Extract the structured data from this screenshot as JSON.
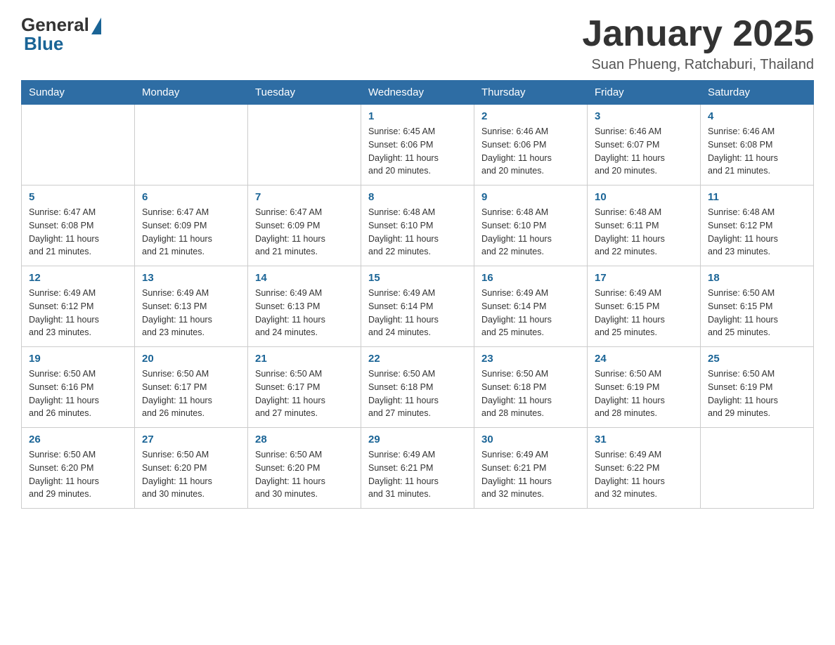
{
  "header": {
    "logo_general": "General",
    "logo_blue": "Blue",
    "month_title": "January 2025",
    "location": "Suan Phueng, Ratchaburi, Thailand"
  },
  "columns": [
    "Sunday",
    "Monday",
    "Tuesday",
    "Wednesday",
    "Thursday",
    "Friday",
    "Saturday"
  ],
  "weeks": [
    [
      {
        "day": "",
        "info": ""
      },
      {
        "day": "",
        "info": ""
      },
      {
        "day": "",
        "info": ""
      },
      {
        "day": "1",
        "info": "Sunrise: 6:45 AM\nSunset: 6:06 PM\nDaylight: 11 hours\nand 20 minutes."
      },
      {
        "day": "2",
        "info": "Sunrise: 6:46 AM\nSunset: 6:06 PM\nDaylight: 11 hours\nand 20 minutes."
      },
      {
        "day": "3",
        "info": "Sunrise: 6:46 AM\nSunset: 6:07 PM\nDaylight: 11 hours\nand 20 minutes."
      },
      {
        "day": "4",
        "info": "Sunrise: 6:46 AM\nSunset: 6:08 PM\nDaylight: 11 hours\nand 21 minutes."
      }
    ],
    [
      {
        "day": "5",
        "info": "Sunrise: 6:47 AM\nSunset: 6:08 PM\nDaylight: 11 hours\nand 21 minutes."
      },
      {
        "day": "6",
        "info": "Sunrise: 6:47 AM\nSunset: 6:09 PM\nDaylight: 11 hours\nand 21 minutes."
      },
      {
        "day": "7",
        "info": "Sunrise: 6:47 AM\nSunset: 6:09 PM\nDaylight: 11 hours\nand 21 minutes."
      },
      {
        "day": "8",
        "info": "Sunrise: 6:48 AM\nSunset: 6:10 PM\nDaylight: 11 hours\nand 22 minutes."
      },
      {
        "day": "9",
        "info": "Sunrise: 6:48 AM\nSunset: 6:10 PM\nDaylight: 11 hours\nand 22 minutes."
      },
      {
        "day": "10",
        "info": "Sunrise: 6:48 AM\nSunset: 6:11 PM\nDaylight: 11 hours\nand 22 minutes."
      },
      {
        "day": "11",
        "info": "Sunrise: 6:48 AM\nSunset: 6:12 PM\nDaylight: 11 hours\nand 23 minutes."
      }
    ],
    [
      {
        "day": "12",
        "info": "Sunrise: 6:49 AM\nSunset: 6:12 PM\nDaylight: 11 hours\nand 23 minutes."
      },
      {
        "day": "13",
        "info": "Sunrise: 6:49 AM\nSunset: 6:13 PM\nDaylight: 11 hours\nand 23 minutes."
      },
      {
        "day": "14",
        "info": "Sunrise: 6:49 AM\nSunset: 6:13 PM\nDaylight: 11 hours\nand 24 minutes."
      },
      {
        "day": "15",
        "info": "Sunrise: 6:49 AM\nSunset: 6:14 PM\nDaylight: 11 hours\nand 24 minutes."
      },
      {
        "day": "16",
        "info": "Sunrise: 6:49 AM\nSunset: 6:14 PM\nDaylight: 11 hours\nand 25 minutes."
      },
      {
        "day": "17",
        "info": "Sunrise: 6:49 AM\nSunset: 6:15 PM\nDaylight: 11 hours\nand 25 minutes."
      },
      {
        "day": "18",
        "info": "Sunrise: 6:50 AM\nSunset: 6:15 PM\nDaylight: 11 hours\nand 25 minutes."
      }
    ],
    [
      {
        "day": "19",
        "info": "Sunrise: 6:50 AM\nSunset: 6:16 PM\nDaylight: 11 hours\nand 26 minutes."
      },
      {
        "day": "20",
        "info": "Sunrise: 6:50 AM\nSunset: 6:17 PM\nDaylight: 11 hours\nand 26 minutes."
      },
      {
        "day": "21",
        "info": "Sunrise: 6:50 AM\nSunset: 6:17 PM\nDaylight: 11 hours\nand 27 minutes."
      },
      {
        "day": "22",
        "info": "Sunrise: 6:50 AM\nSunset: 6:18 PM\nDaylight: 11 hours\nand 27 minutes."
      },
      {
        "day": "23",
        "info": "Sunrise: 6:50 AM\nSunset: 6:18 PM\nDaylight: 11 hours\nand 28 minutes."
      },
      {
        "day": "24",
        "info": "Sunrise: 6:50 AM\nSunset: 6:19 PM\nDaylight: 11 hours\nand 28 minutes."
      },
      {
        "day": "25",
        "info": "Sunrise: 6:50 AM\nSunset: 6:19 PM\nDaylight: 11 hours\nand 29 minutes."
      }
    ],
    [
      {
        "day": "26",
        "info": "Sunrise: 6:50 AM\nSunset: 6:20 PM\nDaylight: 11 hours\nand 29 minutes."
      },
      {
        "day": "27",
        "info": "Sunrise: 6:50 AM\nSunset: 6:20 PM\nDaylight: 11 hours\nand 30 minutes."
      },
      {
        "day": "28",
        "info": "Sunrise: 6:50 AM\nSunset: 6:20 PM\nDaylight: 11 hours\nand 30 minutes."
      },
      {
        "day": "29",
        "info": "Sunrise: 6:49 AM\nSunset: 6:21 PM\nDaylight: 11 hours\nand 31 minutes."
      },
      {
        "day": "30",
        "info": "Sunrise: 6:49 AM\nSunset: 6:21 PM\nDaylight: 11 hours\nand 32 minutes."
      },
      {
        "day": "31",
        "info": "Sunrise: 6:49 AM\nSunset: 6:22 PM\nDaylight: 11 hours\nand 32 minutes."
      },
      {
        "day": "",
        "info": ""
      }
    ]
  ]
}
